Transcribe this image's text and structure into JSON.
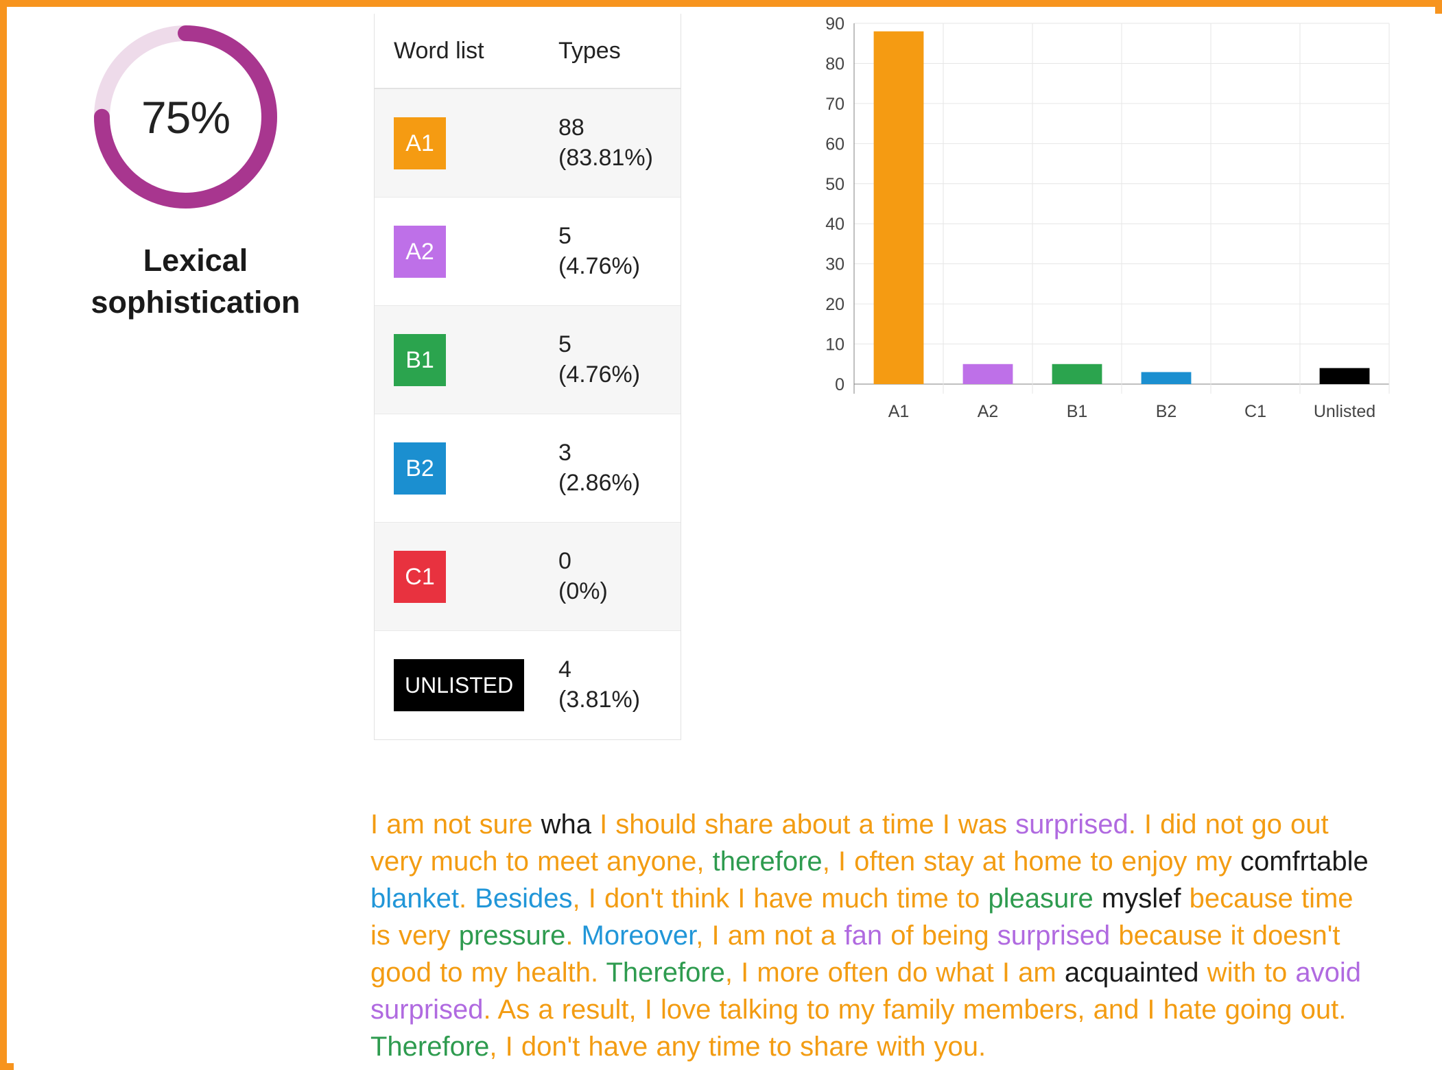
{
  "gauge": {
    "value_label": "75%",
    "percent": 75,
    "caption_line1": "Lexical",
    "caption_line2": "sophistication",
    "arc_color": "#A8368F",
    "track_color": "#EEDBEA"
  },
  "table": {
    "headers": [
      "Word list",
      "Types"
    ],
    "rows": [
      {
        "level": "A1",
        "color": "#F59B12",
        "count": "88",
        "percent": "(83.81%)"
      },
      {
        "level": "A2",
        "color": "#BE70E8",
        "count": "5",
        "percent": "(4.76%)"
      },
      {
        "level": "B1",
        "color": "#2BA44E",
        "count": "5",
        "percent": "(4.76%)"
      },
      {
        "level": "B2",
        "color": "#1B8FD0",
        "count": "3",
        "percent": "(2.86%)"
      },
      {
        "level": "C1",
        "color": "#E8323F",
        "count": "0",
        "percent": "(0%)"
      },
      {
        "level": "UNLISTED",
        "color": "#000000",
        "count": "4",
        "percent": "(3.81%)"
      }
    ]
  },
  "chart_data": {
    "type": "bar",
    "title": "",
    "xlabel": "",
    "ylabel": "",
    "categories": [
      "A1",
      "A2",
      "B1",
      "B2",
      "C1",
      "Unlisted"
    ],
    "values": [
      88,
      5,
      5,
      3,
      0,
      4
    ],
    "colors": [
      "#F59B12",
      "#BE70E8",
      "#2BA44E",
      "#1B8FD0",
      "#E8323F",
      "#000000"
    ],
    "ylim": [
      0,
      90
    ],
    "yticks": [
      0,
      10,
      20,
      30,
      40,
      50,
      60,
      70,
      80,
      90
    ],
    "ytick_labels": [
      "0",
      "10",
      "20",
      "30",
      "40",
      "50",
      "60",
      "70",
      "80",
      "90"
    ],
    "grid": true,
    "legend": "none"
  },
  "palette": {
    "a1_orange": "#F39C12",
    "a2_purple": "#B06AE0",
    "b1_green": "#2E9B4F",
    "b2_blue": "#2196D8",
    "unlisted_black": "#1a1a1a",
    "frame_orange": "#F7941E"
  },
  "essay": {
    "tokens": [
      {
        "t": "I am not sure ",
        "c": "a1"
      },
      {
        "t": "wha",
        "c": "unlisted"
      },
      {
        "t": " I should share about a time I was ",
        "c": "a1"
      },
      {
        "t": "surprised",
        "c": "a2"
      },
      {
        "t": ". I did not go out very much to meet anyone, ",
        "c": "a1"
      },
      {
        "t": "therefore",
        "c": "b1"
      },
      {
        "t": ", I often stay at home to enjoy my ",
        "c": "a1"
      },
      {
        "t": "comfrtable",
        "c": "unlisted"
      },
      {
        "t": " ",
        "c": "a1"
      },
      {
        "t": "blanket",
        "c": "b2"
      },
      {
        "t": ". ",
        "c": "a1"
      },
      {
        "t": "Besides",
        "c": "b2"
      },
      {
        "t": ", I don't think I have much time to ",
        "c": "a1"
      },
      {
        "t": "pleasure",
        "c": "b1"
      },
      {
        "t": " ",
        "c": "a1"
      },
      {
        "t": "myslef",
        "c": "unlisted"
      },
      {
        "t": " because time is very ",
        "c": "a1"
      },
      {
        "t": "pressure",
        "c": "b1"
      },
      {
        "t": ". ",
        "c": "a1"
      },
      {
        "t": "Moreover",
        "c": "b2"
      },
      {
        "t": ", I am not a ",
        "c": "a1"
      },
      {
        "t": "fan",
        "c": "a2"
      },
      {
        "t": " of being ",
        "c": "a1"
      },
      {
        "t": "surprised",
        "c": "a2"
      },
      {
        "t": " because it doesn't good to my health. ",
        "c": "a1"
      },
      {
        "t": "Therefore",
        "c": "b1"
      },
      {
        "t": ", I more often do what I am ",
        "c": "a1"
      },
      {
        "t": "acquainted",
        "c": "unlisted"
      },
      {
        "t": " with to ",
        "c": "a1"
      },
      {
        "t": "avoid",
        "c": "a2"
      },
      {
        "t": " ",
        "c": "a1"
      },
      {
        "t": "surprised",
        "c": "a2"
      },
      {
        "t": ". As a result, I love talking to my family members, and I hate going out. ",
        "c": "a1"
      },
      {
        "t": "Therefore",
        "c": "b1"
      },
      {
        "t": ", I don't have any time to share with you.",
        "c": "a1"
      }
    ]
  }
}
